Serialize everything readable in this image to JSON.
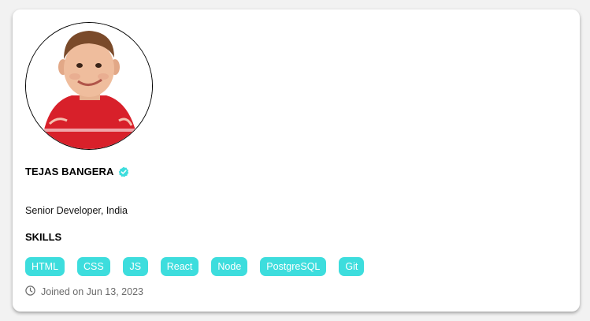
{
  "profile": {
    "name": "TEJAS BANGERA",
    "title": "Senior Developer, India",
    "avatar_icon": "child-portrait",
    "verified_icon": "verified-check-icon",
    "verified_color": "#3ddddd"
  },
  "skills": {
    "heading": "SKILLS",
    "items": [
      "HTML",
      "CSS",
      "JS",
      "React",
      "Node",
      "PostgreSQL",
      "Git"
    ],
    "badge_color": "#3ddddd"
  },
  "meta": {
    "clock_icon": "clock-icon",
    "joined": "Joined on Jun 13, 2023"
  }
}
